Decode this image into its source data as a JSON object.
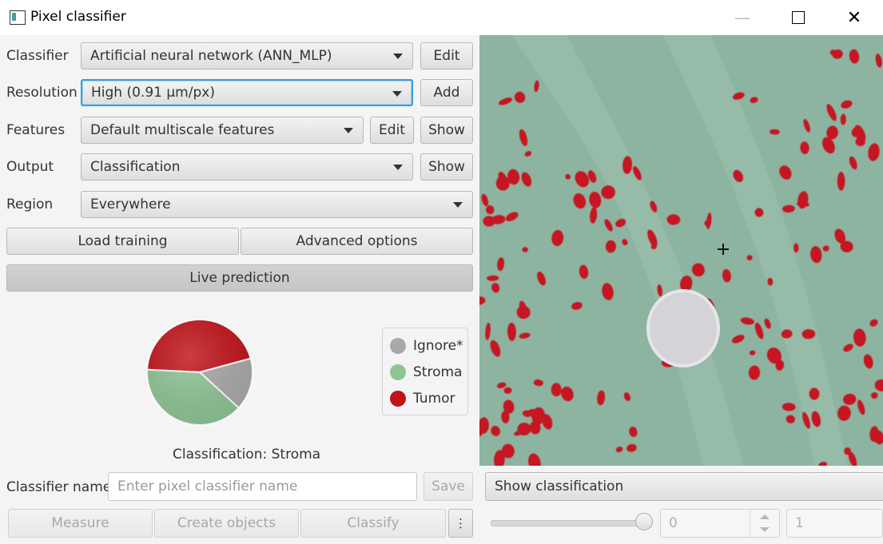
{
  "window": {
    "title": "Pixel classifier"
  },
  "rows": {
    "classifier": {
      "label": "Classifier",
      "value": "Artificial neural network (ANN_MLP)",
      "button": "Edit"
    },
    "resolution": {
      "label": "Resolution",
      "value": "High (0.91 µm/px)",
      "button": "Add"
    },
    "features": {
      "label": "Features",
      "value": "Default multiscale features",
      "button_edit": "Edit",
      "button_show": "Show"
    },
    "output": {
      "label": "Output",
      "value": "Classification",
      "button": "Show"
    },
    "region": {
      "label": "Region",
      "value": "Everywhere"
    }
  },
  "buttons": {
    "load_training": "Load training",
    "advanced_options": "Advanced options",
    "live_prediction": "Live prediction"
  },
  "pie": {
    "caption": "Classification: Stroma",
    "slices": [
      {
        "name": "Tumor",
        "fraction": 0.45,
        "color": "#c0141a"
      },
      {
        "name": "Ignore*",
        "fraction": 0.16,
        "color": "#a9a9a9"
      },
      {
        "name": "Stroma",
        "fraction": 0.39,
        "color": "#8fc495"
      }
    ]
  },
  "legend": [
    {
      "name": "Ignore*",
      "color": "#a9a9a9"
    },
    {
      "name": "Stroma",
      "color": "#8fc495"
    },
    {
      "name": "Tumor",
      "color": "#c0141a"
    }
  ],
  "classifier_name": {
    "label": "Classifier name",
    "placeholder": "Enter pixel classifier name",
    "save": "Save"
  },
  "actions": {
    "measure": "Measure",
    "create_objects": "Create objects",
    "classify": "Classify",
    "more": "⋮"
  },
  "overlay": {
    "display_mode": "Show classification",
    "opacity_fraction": 1.0,
    "spinner1": "0",
    "spinner2": "1"
  }
}
